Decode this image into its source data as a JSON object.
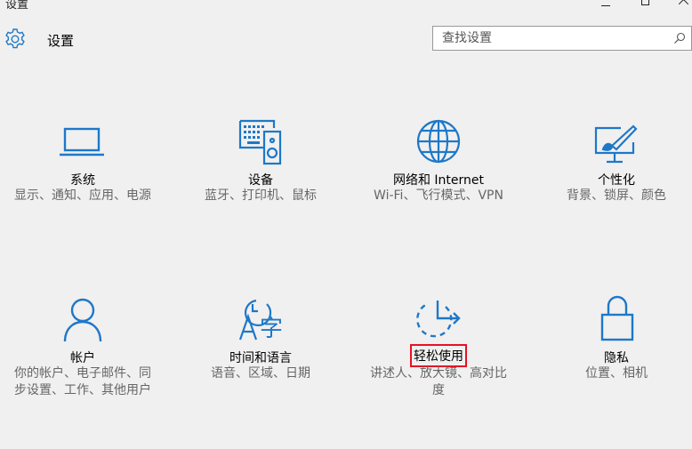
{
  "window": {
    "title": "设置",
    "controls": [
      "minimize",
      "maximize",
      "close"
    ]
  },
  "header": {
    "title": "设置",
    "icon": "gear-icon"
  },
  "search": {
    "placeholder": "查找设置",
    "icon": "search-icon"
  },
  "accent_color": "#1e78c8",
  "highlight_color": "#e81123",
  "tiles": [
    {
      "id": "system",
      "icon": "laptop-icon",
      "title": "系统",
      "desc": "显示、通知、应用、电源"
    },
    {
      "id": "devices",
      "icon": "devices-icon",
      "title": "设备",
      "desc": "蓝牙、打印机、鼠标"
    },
    {
      "id": "network",
      "icon": "globe-icon",
      "title": "网络和 Internet",
      "desc": "Wi-Fi、飞行模式、VPN"
    },
    {
      "id": "personalization",
      "icon": "paint-brush-icon",
      "title": "个性化",
      "desc": "背景、锁屏、颜色"
    },
    {
      "id": "accounts",
      "icon": "person-icon",
      "title": "帐户",
      "desc": "你的帐户、电子邮件、同步设置、工作、其他用户"
    },
    {
      "id": "time-language",
      "icon": "time-language-icon",
      "title": "时间和语言",
      "desc": "语音、区域、日期"
    },
    {
      "id": "ease-of-access",
      "icon": "ease-of-access-icon",
      "title": "轻松使用",
      "desc": "讲述人、放大镜、高对比度",
      "highlighted": true
    },
    {
      "id": "privacy",
      "icon": "lock-icon",
      "title": "隐私",
      "desc": "位置、相机"
    }
  ]
}
